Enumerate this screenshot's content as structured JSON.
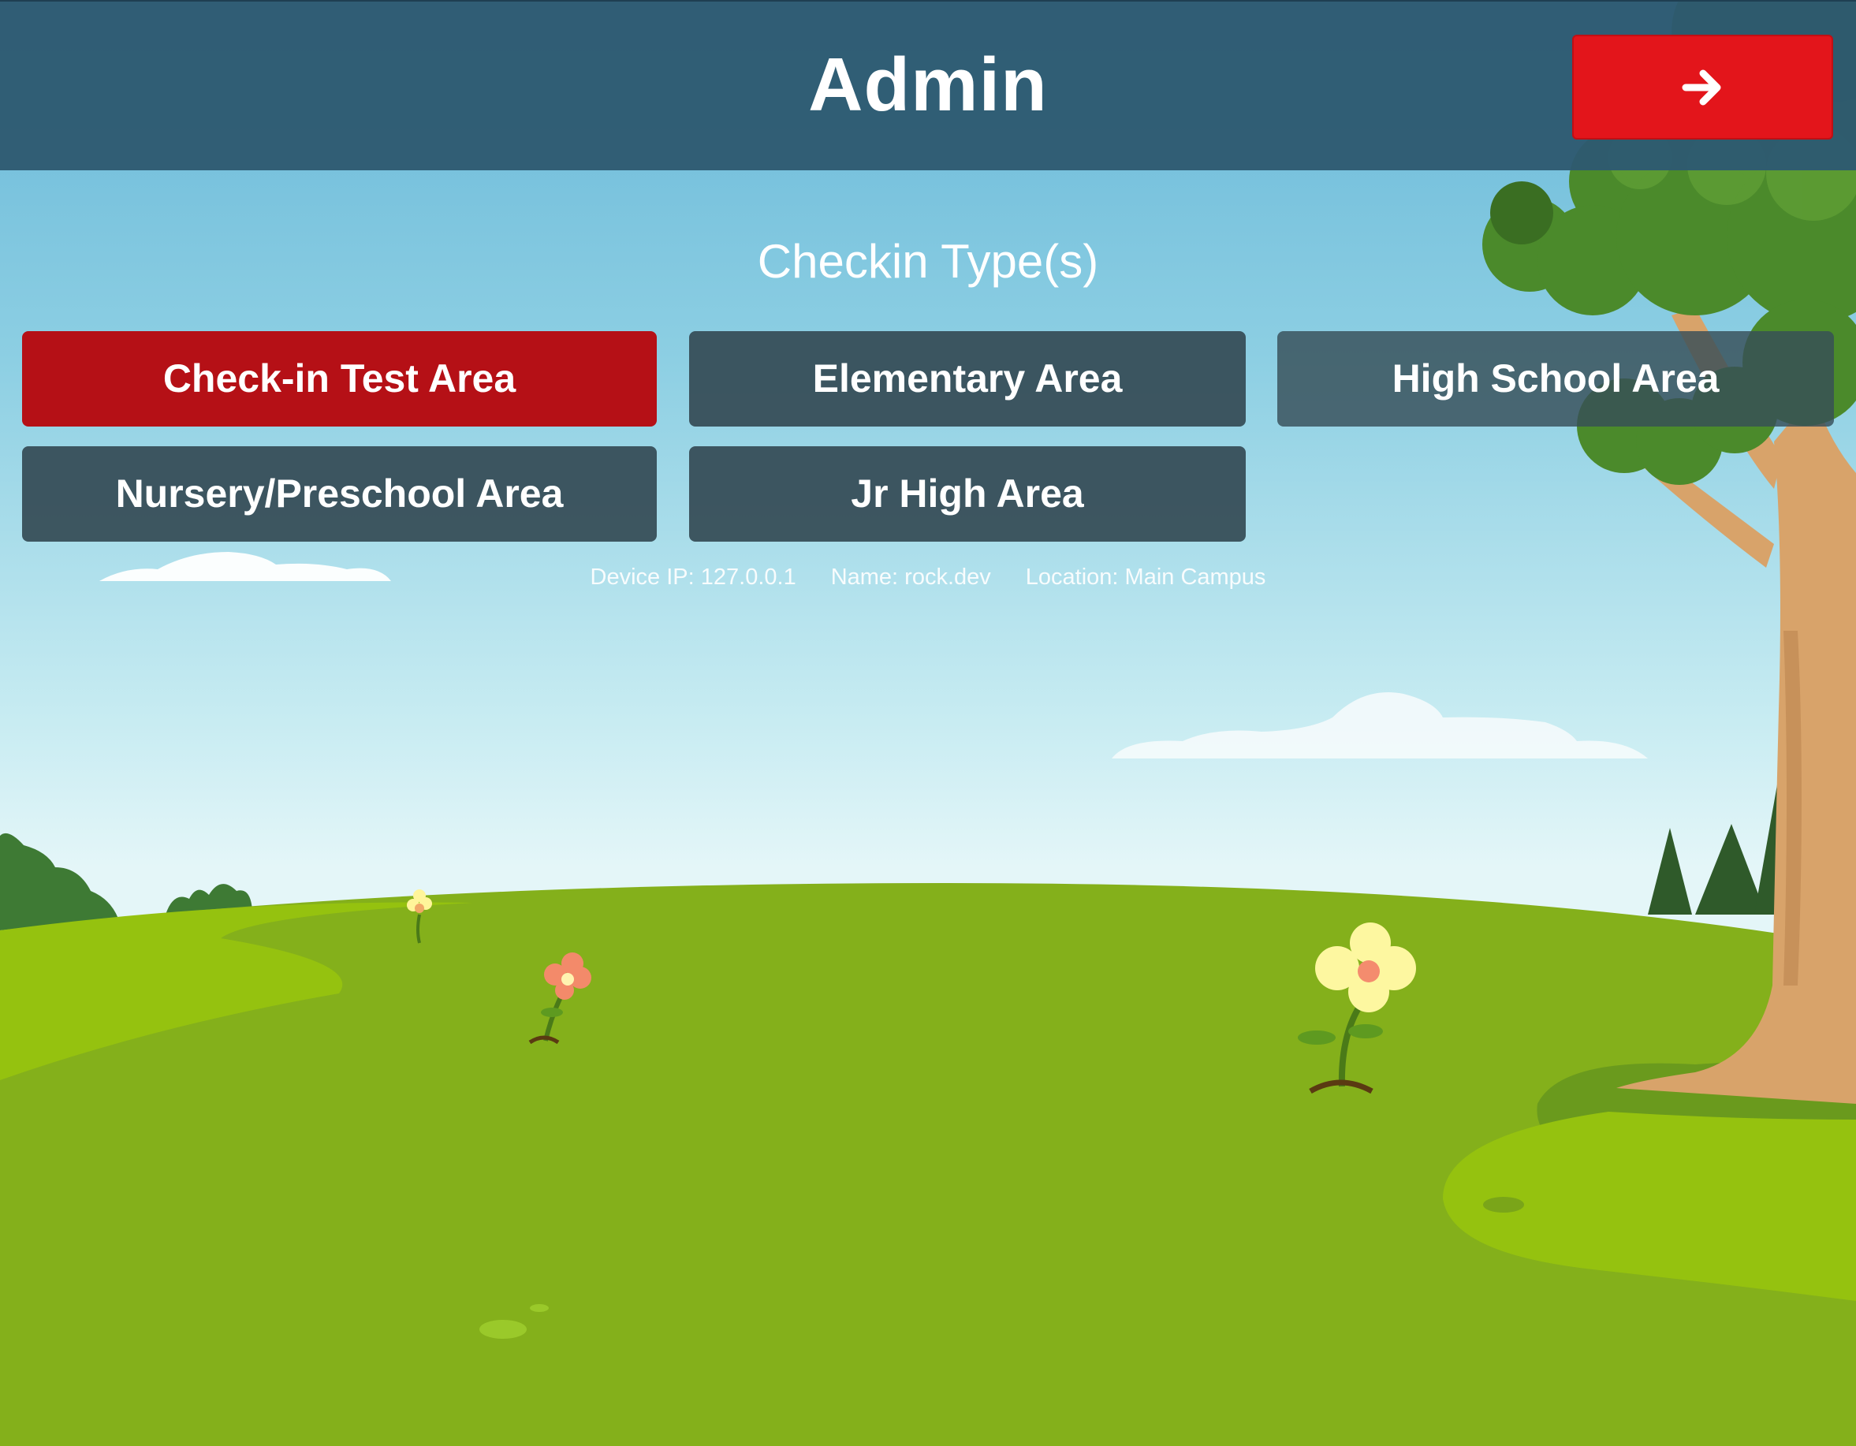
{
  "header": {
    "title": "Admin",
    "next_icon": "arrow-right-icon"
  },
  "main": {
    "section_title": "Checkin Type(s)",
    "areas": [
      {
        "label": "Check-in Test Area",
        "selected": true
      },
      {
        "label": "Elementary Area",
        "selected": false
      },
      {
        "label": "High School Area",
        "selected": false
      },
      {
        "label": "Nursery/Preschool Area",
        "selected": false
      },
      {
        "label": "Jr High Area",
        "selected": false
      }
    ]
  },
  "footer": {
    "device_ip": "Device IP: 127.0.0.1",
    "name": "Name: rock.dev",
    "location": "Location: Main Campus"
  },
  "colors": {
    "header_bg": "#2e5970",
    "accent_red": "#e3151b",
    "selected_area": "#b51016",
    "area_button": "#374e58",
    "grass": "#8ab61c",
    "sky": "#8dcfe3"
  }
}
